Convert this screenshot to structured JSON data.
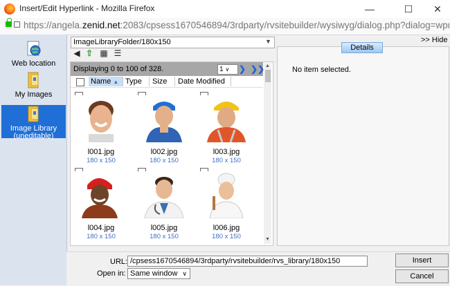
{
  "window": {
    "title": "Insert/Edit Hyperlink - Mozilla Firefox",
    "url_prefix": "https://angela.",
    "url_domain": "zenid.net",
    "url_rest": ":2083/cpsess1670546894/3rdparty/rvsitebuilder/wysiwyg/dialog.php?dialog=wproCore_fileBrc"
  },
  "nav": {
    "items": [
      {
        "label": "Web location",
        "icon": "globe-icon"
      },
      {
        "label": "My Images",
        "icon": "folder-icon"
      },
      {
        "label": "Image Library (uneditable)",
        "icon": "library-folder-icon"
      }
    ]
  },
  "browser": {
    "folder": "ImageLibraryFolder/180x150",
    "status": "Displaying 0 to 100 of 328.",
    "page": "1",
    "columns": [
      "Name",
      "Type",
      "Size",
      "Date Modified"
    ],
    "files": [
      {
        "name": "l001.jpg",
        "dims": "180 x 150"
      },
      {
        "name": "l002.jpg",
        "dims": "180 x 150"
      },
      {
        "name": "l003.jpg",
        "dims": "180 x 150"
      },
      {
        "name": "l004.jpg",
        "dims": "180 x 150"
      },
      {
        "name": "l005.jpg",
        "dims": "180 x 150"
      },
      {
        "name": "l006.jpg",
        "dims": "180 x 150"
      }
    ]
  },
  "details": {
    "hide_label": ">> Hide",
    "tab_label": "Details",
    "empty_text": "No item selected."
  },
  "form": {
    "url_label": "URL:",
    "url_value": "/cpsess1670546894/3rdparty/rvsitebuilder/rvs_library/180x150",
    "open_label": "Open in:",
    "open_value": "Same window",
    "insert_label": "Insert",
    "cancel_label": "Cancel"
  },
  "colors": {
    "accent": "#1f6fd6",
    "nav_bg": "#dbe3ef",
    "status_bg": "#a7a7a7"
  }
}
